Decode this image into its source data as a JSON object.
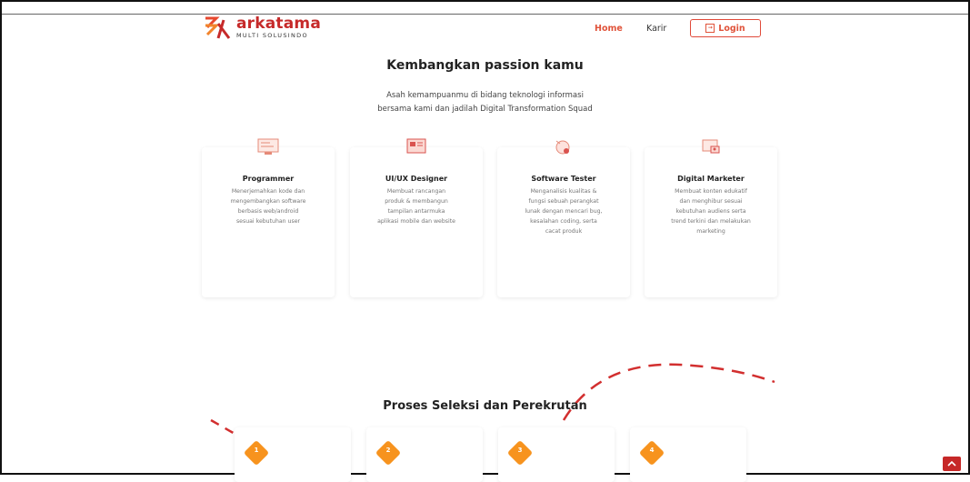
{
  "header": {
    "brand": "arkatama",
    "brand_sub": "MULTI SOLUSINDO",
    "nav": {
      "home": "Home",
      "karir": "Karir",
      "login": "Login"
    }
  },
  "hero": {
    "title": "Kembangkan passion kamu",
    "desc_line1": "Asah kemampuanmu di bidang teknologi informasi",
    "desc_line2": "bersama kami dan jadilah Digital Transformation Squad"
  },
  "cards": [
    {
      "title": "Programmer",
      "icon": "code-screen-icon",
      "lines": [
        "Menerjemahkan kode dan",
        "mengembangkan software",
        "berbasis web/android",
        "sesuai kebutuhan user"
      ]
    },
    {
      "title": "UI/UX Designer",
      "icon": "design-board-icon",
      "lines": [
        "Membuat rancangan",
        "produk & membangun",
        "tampilan antarmuka",
        "aplikasi mobile dan website"
      ]
    },
    {
      "title": "Software Tester",
      "icon": "bug-test-icon",
      "lines": [
        "Menganalisis kualitas &",
        "fungsi sebuah perangkat",
        "lunak dengan mencari bug,",
        "kesalahan coding, serta",
        "cacat produk"
      ]
    },
    {
      "title": "Digital Marketer",
      "icon": "marketing-screen-icon",
      "lines": [
        "Membuat konten edukatif",
        "dan menghibur sesuai",
        "kebutuhan audiens serta",
        "trend terkini dan melakukan",
        "marketing"
      ]
    }
  ],
  "process": {
    "title": "Proses Seleksi dan Perekrutan",
    "steps": [
      "1",
      "2",
      "3",
      "4"
    ]
  },
  "colors": {
    "brand_red": "#c62a2a",
    "accent_orange": "#f7931e",
    "nav_active": "#e0533a"
  }
}
